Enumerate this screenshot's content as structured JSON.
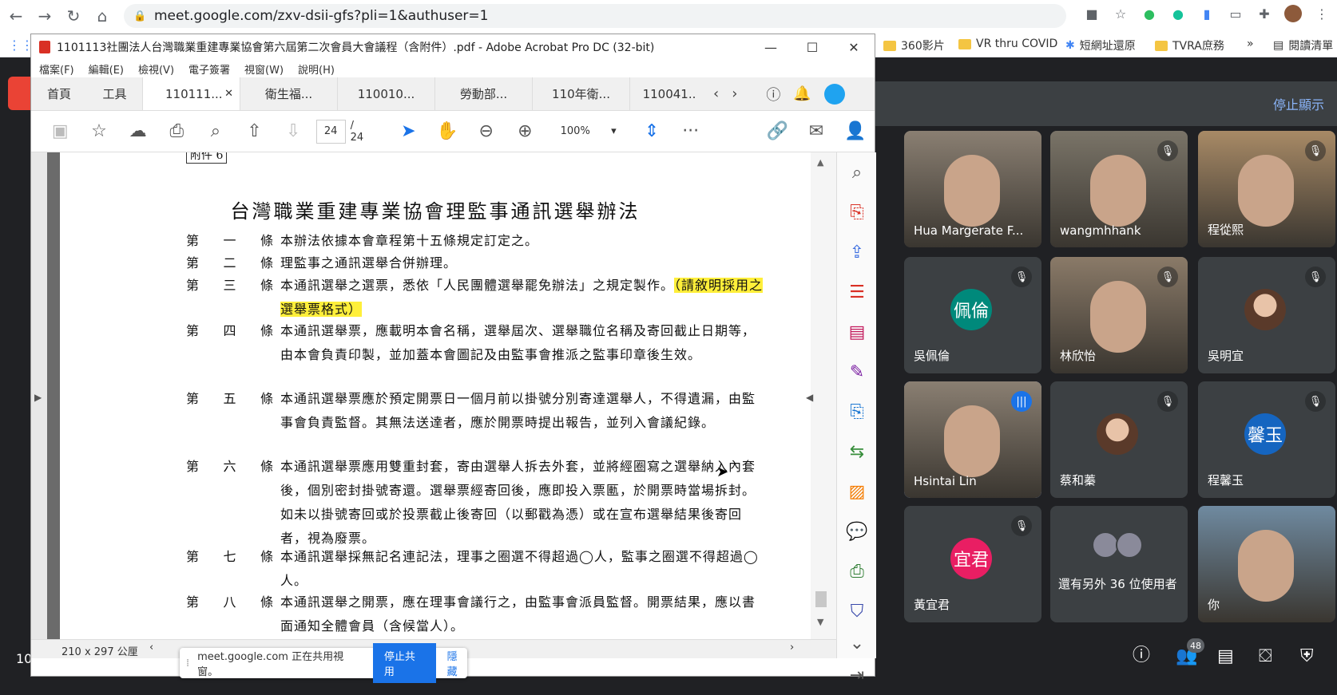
{
  "browser": {
    "url": "meet.google.com/zxv-dsii-gfs?pli=1&authuser=1",
    "bookmarks": [
      "360影片",
      "VR thru COVID",
      "短網址還原",
      "TVRA庶務",
      "»",
      "閱讀清單"
    ]
  },
  "acrobat": {
    "title": "1101113社團法人台灣職業重建專業協會第六屆第二次會員大會議程（含附件）.pdf - Adobe Acrobat Pro DC (32-bit)",
    "menu": [
      "檔案(F)",
      "編輯(E)",
      "檢視(V)",
      "電子簽署",
      "視窗(W)",
      "說明(H)"
    ],
    "tabs": {
      "home": "首頁",
      "tools": "工具",
      "active": "110111...",
      "others": [
        "衛生福...",
        "110010...",
        "勞動部...",
        "110年衛...",
        "110041.."
      ]
    },
    "page_current": "24",
    "page_total": "/ 24",
    "zoom": "100%",
    "status_size": "210 x 297 公厘"
  },
  "document": {
    "attachment": "附件 6",
    "title": "台灣職業重建專業協會理監事通訊選舉辦法",
    "articles": [
      {
        "label": [
          "第",
          "一",
          "條"
        ],
        "text": "本辦法依據本會章程第十五條規定訂定之。"
      },
      {
        "label": [
          "第",
          "二",
          "條"
        ],
        "text": "理監事之通訊選舉合併辦理。"
      },
      {
        "label": [
          "第",
          "三",
          "條"
        ],
        "text": "本通訊選舉之選票，悉依「人民團體選舉罷免辦法」之規定製作。",
        "highlight": "（請敘明採用之選舉票格式）"
      },
      {
        "label": [
          "第",
          "四",
          "條"
        ],
        "text": "本通訊選舉票，應載明本會名稱，選舉屆次、選舉職位名稱及寄回截止日期等，由本會負責印製，並加蓋本會圖記及由監事會推派之監事印章後生效。"
      },
      {
        "label": [
          "第",
          "五",
          "條"
        ],
        "text": "本通訊選舉票應於預定開票日一個月前以掛號分別寄達選舉人，不得遺漏，由監事會負責監督。其無法送達者，應於開票時提出報告，並列入會議紀錄。"
      },
      {
        "label": [
          "第",
          "六",
          "條"
        ],
        "text": "本通訊選舉票應用雙重封套，寄由選舉人拆去外套，並將經圈寫之選舉納入內套後，個別密封掛號寄還。選舉票經寄回後，應即投入票匭，於開票時當場拆封。如未以掛號寄回或於投票截止後寄回（以郵戳為憑）或在宣布選舉結果後寄回者，視為廢票。"
      },
      {
        "label": [
          "第",
          "七",
          "條"
        ],
        "text": "本通訊選舉採無記名連記法，理事之圈選不得超過◯人，監事之圈選不得超過◯人。"
      },
      {
        "label": [
          "第",
          "八",
          "條"
        ],
        "text": "本通訊選舉之開票，應在理事會議行之，由監事會派員監督。開票結果，應以書面通知全體會員（含候當人）。"
      }
    ]
  },
  "meet": {
    "stop_presenting": "停止顯示",
    "participants_count": "48",
    "left_number": "10",
    "share_notice": "meet.google.com 正在共用視窗。",
    "share_stop": "停止共用",
    "share_hide": "隱藏",
    "tiles": [
      {
        "name": "Hua Margerate F...",
        "type": "video",
        "muted": false
      },
      {
        "name": "wangmhhank",
        "type": "video",
        "muted": true
      },
      {
        "name": "程從熙",
        "type": "video",
        "muted": true
      },
      {
        "name": "吳佩倫",
        "type": "avatar",
        "initial": "佩倫",
        "color": "#00897b",
        "muted": true
      },
      {
        "name": "林欣怡",
        "type": "video",
        "muted": true
      },
      {
        "name": "吳明宜",
        "type": "photo",
        "muted": true
      },
      {
        "name": "Hsintai Lin",
        "type": "video",
        "muted": false,
        "speaking": true
      },
      {
        "name": "蔡和蓁",
        "type": "photo",
        "muted": true
      },
      {
        "name": "程馨玉",
        "type": "avatar",
        "initial": "馨玉",
        "color": "#1565c0",
        "muted": true
      },
      {
        "name": "黃宜君",
        "type": "avatar",
        "initial": "宜君",
        "color": "#e91e63",
        "muted": true
      },
      {
        "name": "還有另外 36 位使用者",
        "type": "others",
        "muted": false
      },
      {
        "name": "你",
        "type": "video",
        "muted": false
      }
    ]
  }
}
